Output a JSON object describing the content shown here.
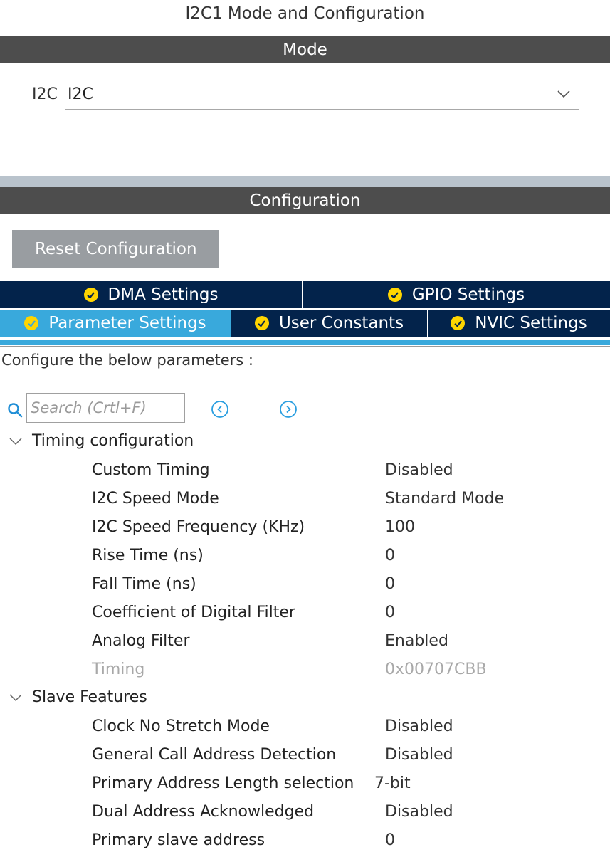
{
  "title": "I2C1 Mode and Configuration",
  "mode_band": "Mode",
  "mode": {
    "label": "I2C",
    "value": "I2C"
  },
  "config_band": "Configuration",
  "reset_button": "Reset Configuration",
  "tabs": {
    "dma": "DMA Settings",
    "gpio": "GPIO Settings",
    "parameter": "Parameter Settings",
    "user_constants": "User Constants",
    "nvic": "NVIC Settings"
  },
  "subtitle": "Configure the below parameters :",
  "search": {
    "placeholder": "Search (Crtl+F)"
  },
  "groups": [
    {
      "title": "Timing configuration",
      "rows": [
        {
          "key": "Custom Timing",
          "value": "Disabled"
        },
        {
          "key": "I2C Speed Mode",
          "value": "Standard Mode"
        },
        {
          "key": "I2C Speed Frequency (KHz)",
          "value": "100"
        },
        {
          "key": "Rise Time (ns)",
          "value": "0"
        },
        {
          "key": "Fall Time (ns)",
          "value": "0"
        },
        {
          "key": "Coefficient of Digital Filter",
          "value": "0"
        },
        {
          "key": "Analog Filter",
          "value": "Enabled"
        },
        {
          "key": "Timing",
          "value": "0x00707CBB"
        }
      ]
    },
    {
      "title": "Slave Features",
      "rows": [
        {
          "key": "Clock No Stretch Mode",
          "value": "Disabled"
        },
        {
          "key": "General Call Address Detection",
          "value": "Disabled"
        },
        {
          "key": "Primary Address Length selection",
          "value": "7-bit"
        },
        {
          "key": "Dual Address Acknowledged",
          "value": "Disabled"
        },
        {
          "key": "Primary slave address",
          "value": "0"
        }
      ]
    }
  ],
  "colors": {
    "band": "#4d4d4d",
    "tab_dark": "#03234b",
    "tab_active": "#39a9dc",
    "check": "#ffd500",
    "disabled_text": "#a8a8a8"
  }
}
